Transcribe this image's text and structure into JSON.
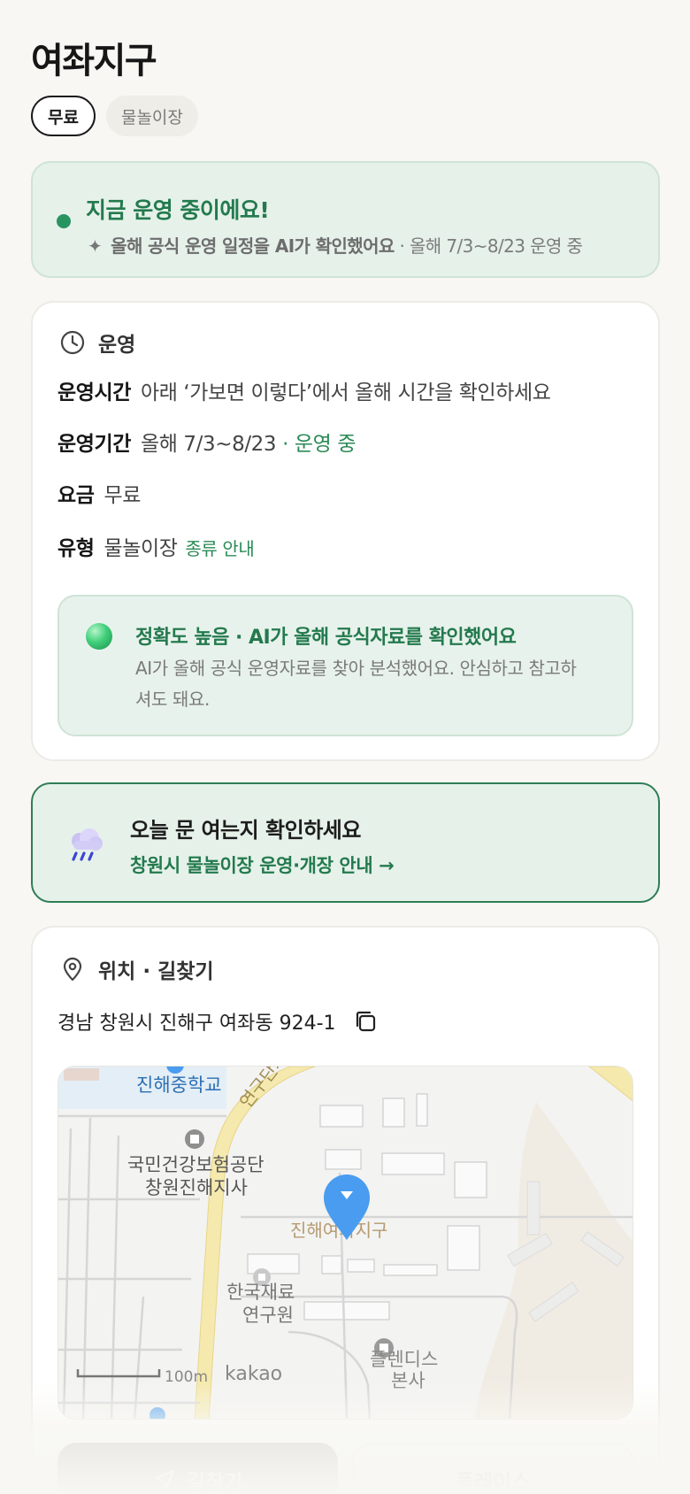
{
  "page": {
    "title": "여좌지구"
  },
  "chips": [
    {
      "label": "무료"
    },
    {
      "label": "물놀이장"
    }
  ],
  "status": {
    "title": "지금 운영 중이에요!",
    "spark_icon": "sparkle-icon",
    "ai_note": "올해 공식 운영 일정을 AI가 확인했어요",
    "period_note": "· 올해 7/3~8/23 운영 중",
    "dot_color": "#2a9460"
  },
  "operation": {
    "heading": "운영",
    "icon": "clock-icon",
    "hours_label": "운영시간",
    "hours_value": "아래 ‘가보면 이렇다’에서 올해 시간을 확인하세요",
    "period_label": "운영기간",
    "period_value": "올해 7/3~8/23",
    "period_status": "· 운영 중",
    "fee_label": "요금",
    "fee_value": "무료",
    "type_label": "유형",
    "type_value": "물놀이장",
    "type_link": "종류 안내",
    "accuracy_title": "정확도 높음 · AI가 올해 공식자료를 확인했어요",
    "accuracy_desc": "AI가 올해 공식 운영자료를 찾아 분석했어요. 안심하고 참고하셔도 돼요."
  },
  "notice": {
    "icon": "rain-cloud-icon",
    "title": "오늘 문 여는지 확인하세요",
    "link": "창원시 물놀이장 운영·개장 안내 →"
  },
  "location": {
    "heading": "위치 · 길찾기",
    "icon": "map-pin-icon",
    "address": "경남 창원시 진해구 여좌동 924-1",
    "map": {
      "label_school": "진해중학교",
      "label_nhis_1": "국민건강보험공단",
      "label_nhis_2": "창원진해지사",
      "label_place": "진해여좌지구",
      "label_kims_1": "한국재료",
      "label_kims_2": "연구원",
      "label_pledis_1": "플렌디스",
      "label_pledis_2": "본사",
      "label_road": "연구단지",
      "scale": "100m",
      "brand": "kakao",
      "pin_color": "#4a9cf0"
    },
    "btn_route": "길찾기",
    "btn_place": "플레이스"
  },
  "colors": {
    "accent_green": "#237a4d",
    "soft_green_bg": "#e6f1ea",
    "page_bg": "#f8f7f3"
  }
}
